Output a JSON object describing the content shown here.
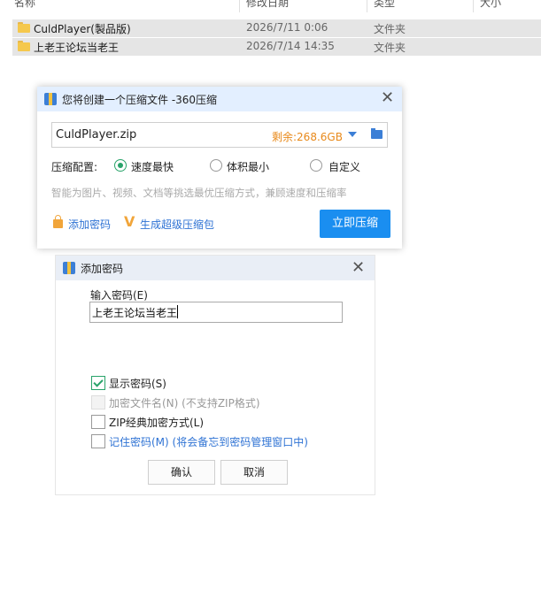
{
  "explorer": {
    "columns": [
      "名称",
      "修改日期",
      "类型",
      "大小"
    ],
    "rows": [
      {
        "name": "CuldPlayer(製品版)",
        "date": "2026/7/11 0:06",
        "type": "文件夹"
      },
      {
        "name": "上老王论坛当老王",
        "date": "2026/7/14 14:35",
        "type": "文件夹"
      }
    ]
  },
  "compress_dialog": {
    "title": "您将创建一个压缩文件 -360压缩",
    "filename": "CuldPlayer.zip",
    "free_space": "剩余:268.6GB",
    "config_label": "压缩配置:",
    "options": [
      "速度最快",
      "体积最小",
      "自定义"
    ],
    "selected_option": "速度最快",
    "hint": "智能为图片、视频、文档等挑选最优压缩方式，兼顾速度和压缩率",
    "add_password": "添加密码",
    "super_pack": "生成超级压缩包",
    "compress_button": "立即压缩",
    "accent_color": "#1a8ef0"
  },
  "password_dialog": {
    "title": "添加密码",
    "input_label": "输入密码(E)",
    "password_value": "上老王论坛当老王",
    "checkboxes": [
      {
        "label": "显示密码(S)",
        "checked": true,
        "enabled": true
      },
      {
        "label": "加密文件名(N) (不支持ZIP格式)",
        "checked": false,
        "enabled": false
      },
      {
        "label": "ZIP经典加密方式(L)",
        "checked": false,
        "enabled": true
      },
      {
        "label": "记住密码(M) (将会备忘到密码管理窗口中)",
        "checked": false,
        "enabled": true
      }
    ],
    "ok_button": "确认",
    "cancel_button": "取消"
  }
}
